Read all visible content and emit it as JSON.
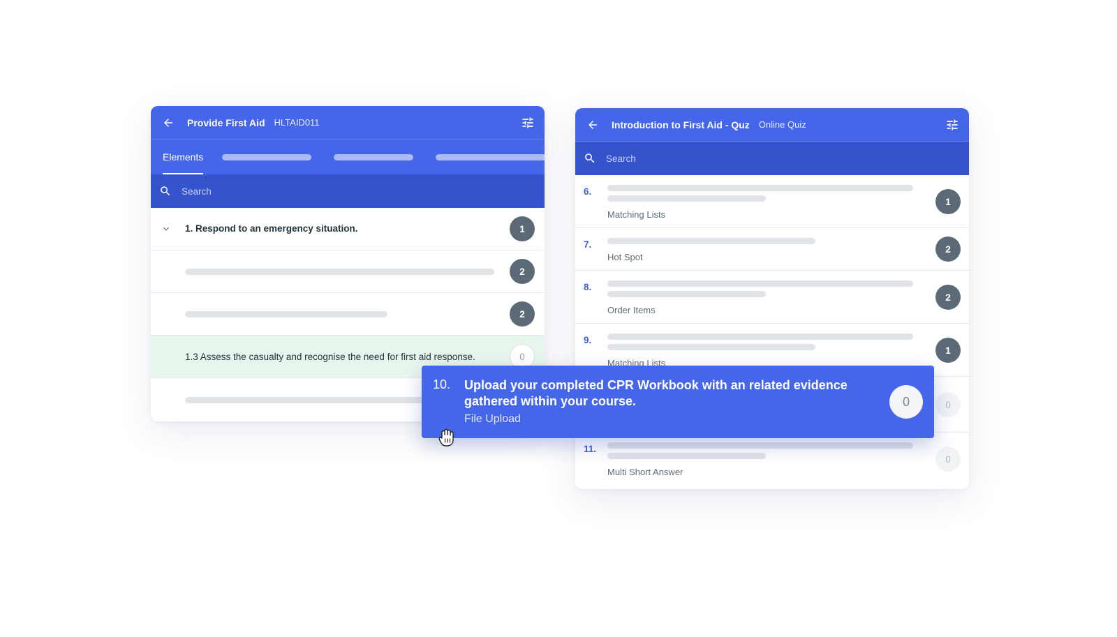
{
  "left_panel": {
    "title": "Provide First Aid",
    "code": "HLTAID011",
    "tabs": {
      "active_label": "Elements"
    },
    "search": {
      "placeholder": "Search"
    },
    "rows": [
      {
        "label": "1. Respond to an emergency situation.",
        "count": "1"
      },
      {
        "count": "2"
      },
      {
        "count": "2"
      },
      {
        "label": "1.3 Assess the casualty and recognise the need for first aid response.",
        "count": "0"
      }
    ]
  },
  "right_panel": {
    "title": "Introduction to First Aid - Quz",
    "subtitle": "Online Quiz",
    "search": {
      "placeholder": "Search"
    },
    "questions": [
      {
        "number": "6.",
        "type": "Matching Lists",
        "count": "1"
      },
      {
        "number": "7.",
        "type": "Hot Spot",
        "count": "2"
      },
      {
        "number": "8.",
        "type": "Order Items",
        "count": "2"
      },
      {
        "number": "9.",
        "type": "Matching Lists",
        "count": "1"
      },
      {
        "count": "0"
      },
      {
        "number": "11.",
        "type": "Multi Short Answer",
        "count": "0"
      }
    ]
  },
  "drag_item": {
    "number": "10.",
    "text": "Upload your completed CPR Workbook with an related evidence gathered within your course.",
    "type": "File Upload",
    "count": "0"
  },
  "icons": {
    "back": "arrow-left-icon",
    "filter": "sliders-icon",
    "search": "search-icon",
    "expand": "chevron-down-icon",
    "cursor": "grab-hand-icon"
  },
  "colors": {
    "primary": "#4566e8",
    "search_bar": "#3553cc",
    "badge_dark": "#5c6a78",
    "highlight_row": "#e7f6ed",
    "question_number": "#3d5ce0"
  }
}
